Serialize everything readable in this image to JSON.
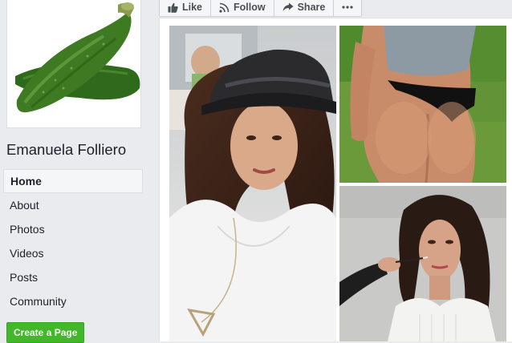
{
  "page": {
    "name": "Emanuela Folliero",
    "profile_picture": "zucchini-photo"
  },
  "actions": [
    {
      "label": "Like",
      "icon": "thumbs-up-icon"
    },
    {
      "label": "Follow",
      "icon": "rss-icon"
    },
    {
      "label": "Share",
      "icon": "share-arrow-icon"
    },
    {
      "label": "",
      "icon": "more-dots-icon"
    }
  ],
  "nav": {
    "items": [
      {
        "label": "Home",
        "active": true
      },
      {
        "label": "About"
      },
      {
        "label": "Photos"
      },
      {
        "label": "Videos"
      },
      {
        "label": "Posts"
      },
      {
        "label": "Community"
      }
    ],
    "create_page_label": "Create a Page"
  },
  "photos": [
    {
      "subject": "woman-in-hat-selfie"
    },
    {
      "subject": "person-in-swimwear-rear-view"
    },
    {
      "subject": "woman-getting-makeup-applied"
    }
  ],
  "colors": {
    "background": "#e9ebee",
    "text": "#1d2129",
    "button_green": "#42b72a",
    "action_text": "#4b4f56"
  }
}
